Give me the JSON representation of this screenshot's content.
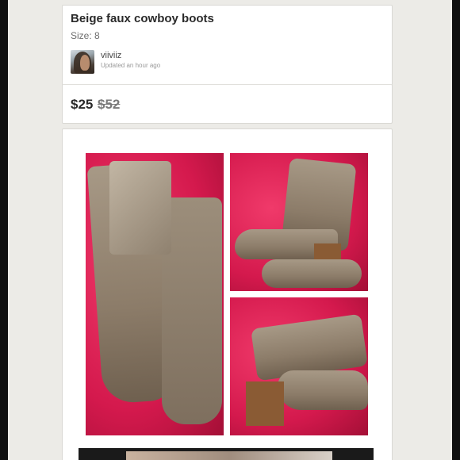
{
  "listing": {
    "title": "Beige faux cowboy boots",
    "size": "Size: 8",
    "seller": {
      "username": "viiviiz",
      "updated": "Updated an hour ago"
    },
    "price": "$25",
    "original_price": "$52"
  },
  "colors": {
    "background": "#ecebe7",
    "card": "#ffffff",
    "photo_backdrop": "#d4194d",
    "boot": "#a79986"
  }
}
